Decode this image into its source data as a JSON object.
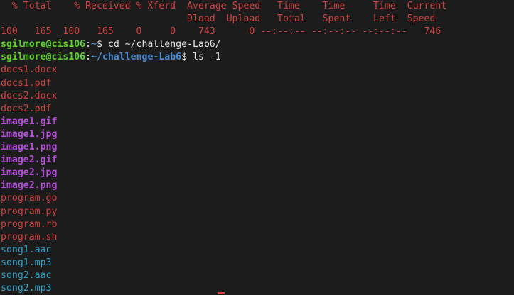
{
  "curl_progress": {
    "header_line1": "  % Total    % Received % Xferd  Average Speed   Time    Time     Time  Current",
    "header_line2": "                                 Dload  Upload   Total   Spent    Left  Speed",
    "values_line": "100   165  100   165    0     0    743      0 --:--:-- --:--:-- --:--:--   746"
  },
  "commands": [
    {
      "user_host": "sgilmore@cis106",
      "separator": ":",
      "path": "~",
      "prompt_symbol": "$",
      "command": " cd ~/challenge-Lab6/"
    },
    {
      "user_host": "sgilmore@cis106",
      "separator": ":",
      "path": "~/challenge-Lab6",
      "prompt_symbol": "$",
      "command": " ls -1"
    }
  ],
  "listing": {
    "documents": [
      "docs1.docx",
      "docs1.pdf",
      "docs2.docx",
      "docs2.pdf"
    ],
    "images": [
      "image1.gif",
      "image1.jpg",
      "image1.png",
      "image2.gif",
      "image2.jpg",
      "image2.png"
    ],
    "programs": [
      "program.go",
      "program.py",
      "program.rb",
      "program.sh"
    ],
    "audio": [
      "song1.aac",
      "song1.mp3",
      "song2.aac",
      "song2.mp3"
    ]
  },
  "colors": {
    "background": "#1c1c1c",
    "red_text": "#d14242",
    "prompt_user": "#5fd32a",
    "prompt_path": "#4d8ed6",
    "image_files": "#b44fd8",
    "audio_files": "#30a5c8",
    "default_text": "#e6e6e6"
  }
}
